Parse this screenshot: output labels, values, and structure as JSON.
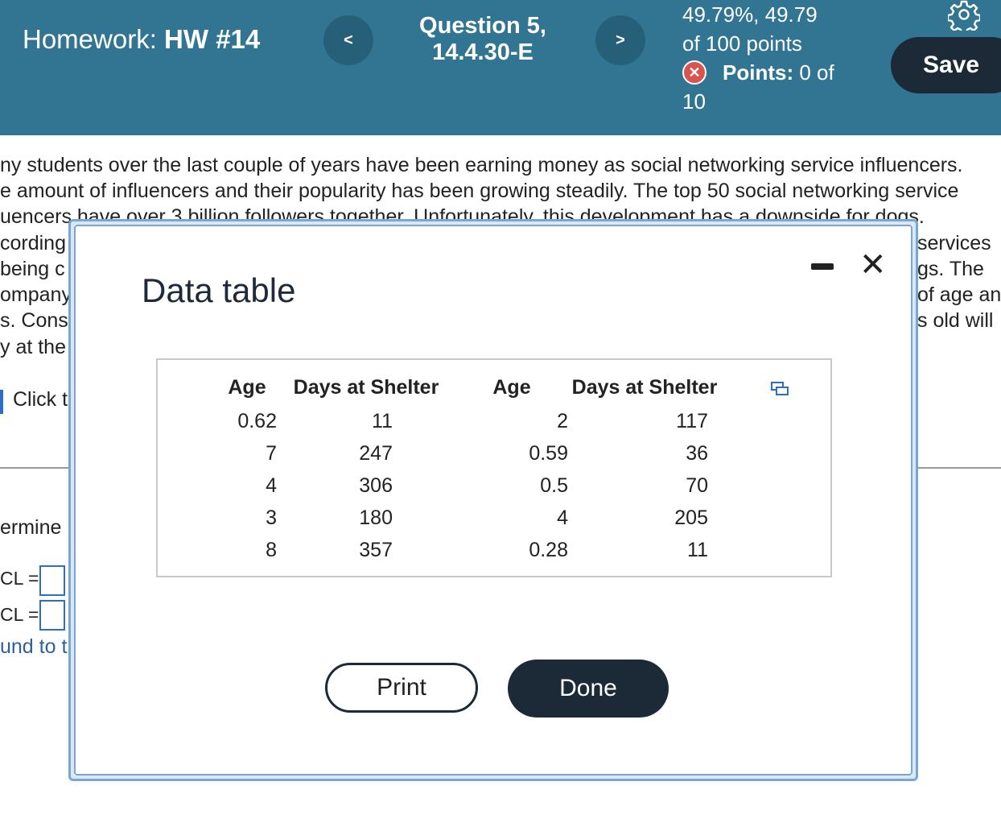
{
  "header": {
    "homework_label": "Homework:",
    "homework_name": "HW #14",
    "question_line1": "Question 5,",
    "question_line2": "14.4.30-E",
    "prev_glyph": "<",
    "next_glyph": ">",
    "score_line1": "49.79%, 49.79",
    "score_line2": "of 100 points",
    "points_label": "Points:",
    "points_value": "0 of",
    "points_total": "10",
    "save_label": "Save",
    "incorrect_icon": "x-circle-icon",
    "settings_icon": "gear-icon"
  },
  "background": {
    "lines": [
      "ny students over the last couple of years have been earning money as social networking service influencers.",
      "e amount of influencers and their popularity has been growing steadily. The top 50 social networking service",
      "uencers have over 3 billion followers together. Unfortunately, this development has a downside for dogs."
    ],
    "left_fragments": [
      "cording t",
      "being c",
      "ompany",
      "s. Cons",
      "y at the"
    ],
    "right_fragments": [
      "services",
      "gs. The",
      "of age an",
      "s old will"
    ],
    "click_text": "Click t",
    "determine_text": "ermine",
    "lcl_label": "CL =",
    "ucl_label": "CL =",
    "round_text": "und to t"
  },
  "modal": {
    "title": "Data table",
    "minimize_icon": "minimize-icon",
    "close_icon": "close-icon",
    "close_glyph": "✕",
    "copy_icon": "copy-icon",
    "print_label": "Print",
    "done_label": "Done",
    "table": {
      "headers": [
        "Age",
        "Days at Shelter",
        "Age",
        "Days at Shelter"
      ],
      "rows": [
        [
          "0.62",
          "11",
          "2",
          "117"
        ],
        [
          "7",
          "247",
          "0.59",
          "36"
        ],
        [
          "4",
          "306",
          "0.5",
          "70"
        ],
        [
          "3",
          "180",
          "4",
          "205"
        ],
        [
          "8",
          "357",
          "0.28",
          "11"
        ]
      ]
    }
  }
}
